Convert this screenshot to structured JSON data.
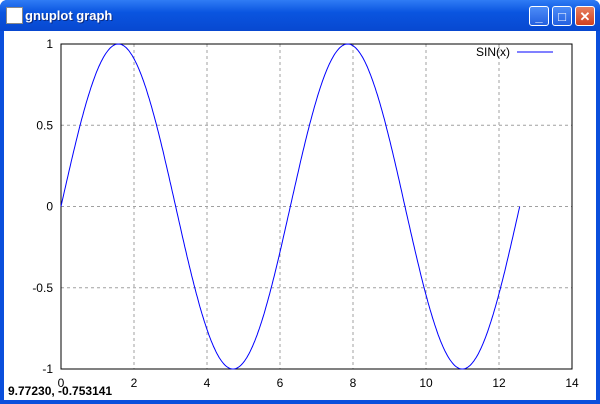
{
  "window": {
    "title": "gnuplot graph",
    "minimize": "_",
    "maximize": "□",
    "close": "✕"
  },
  "status": {
    "mouse_coords": "9.77230, -0.753141"
  },
  "colors": {
    "series": "#0000ff",
    "grid": "#a0a0a0",
    "titlebar": "#0a55e0"
  },
  "chart_data": {
    "type": "line",
    "title": "",
    "xlabel": "",
    "ylabel": "",
    "xlim": [
      0,
      14
    ],
    "ylim": [
      -1,
      1
    ],
    "xticks": [
      0,
      2,
      4,
      6,
      8,
      10,
      12,
      14
    ],
    "yticks": [
      -1,
      -0.5,
      0,
      0.5,
      1
    ],
    "grid": true,
    "legend": "top-right",
    "series": [
      {
        "name": "SIN(x)",
        "function": "sin(x)",
        "x_range": [
          0,
          12.566
        ],
        "color": "#0000ff"
      }
    ]
  }
}
